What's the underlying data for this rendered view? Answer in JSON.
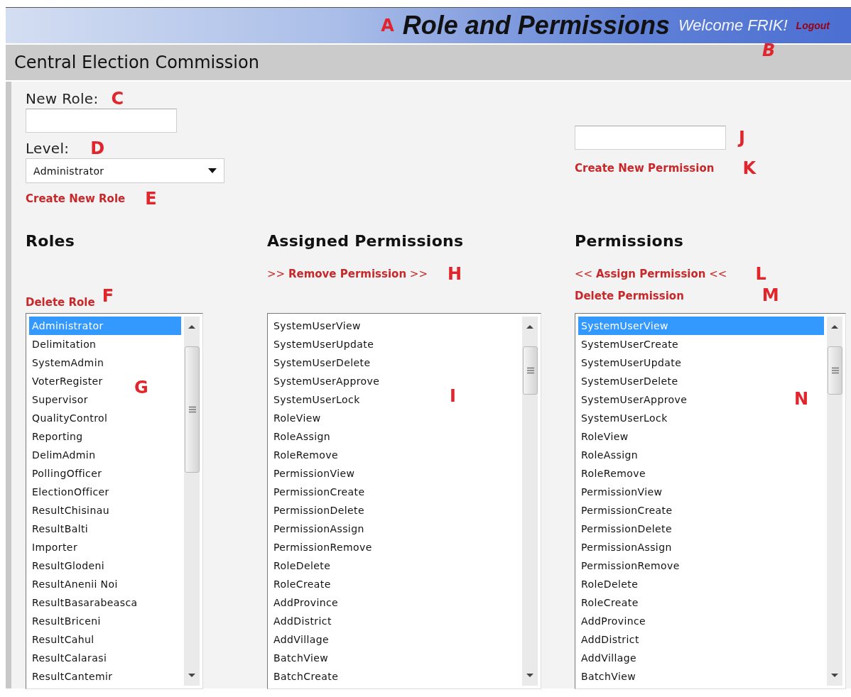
{
  "header": {
    "callout": "A",
    "title": "Role and Permissions",
    "welcome": "Welcome FRIK!",
    "welcome_callout": "B",
    "logout": "Logout"
  },
  "organization": "Central Election Commission",
  "new_role": {
    "label": "New Role:",
    "callout": "C"
  },
  "level": {
    "label": "Level:",
    "callout": "D",
    "value": "Administrator"
  },
  "create_role_link": {
    "text": "Create New Role",
    "callout": "E"
  },
  "new_permission": {
    "callout": "J"
  },
  "create_permission_link": {
    "text": "Create New Permission",
    "callout": "K"
  },
  "roles": {
    "heading": "Roles",
    "delete_link": {
      "text": "Delete Role",
      "callout": "F"
    },
    "list_callout": "G",
    "items": [
      {
        "label": "Administrator",
        "selected": true
      },
      {
        "label": "Delimitation",
        "selected": false
      },
      {
        "label": "SystemAdmin",
        "selected": false
      },
      {
        "label": "VoterRegister",
        "selected": false
      },
      {
        "label": "Supervisor",
        "selected": false
      },
      {
        "label": "QualityControl",
        "selected": false
      },
      {
        "label": "Reporting",
        "selected": false
      },
      {
        "label": "DelimAdmin",
        "selected": false
      },
      {
        "label": "PollingOfficer",
        "selected": false
      },
      {
        "label": "ElectionOfficer",
        "selected": false
      },
      {
        "label": "ResultChisinau",
        "selected": false
      },
      {
        "label": "ResultBalti",
        "selected": false
      },
      {
        "label": "Importer",
        "selected": false
      },
      {
        "label": "ResultGlodeni",
        "selected": false
      },
      {
        "label": "ResultAnenii Noi",
        "selected": false
      },
      {
        "label": "ResultBasarabeasca",
        "selected": false
      },
      {
        "label": "ResultBriceni",
        "selected": false
      },
      {
        "label": "ResultCahul",
        "selected": false
      },
      {
        "label": "ResultCalarasi",
        "selected": false
      },
      {
        "label": "ResultCantemir",
        "selected": false
      }
    ]
  },
  "assigned": {
    "heading": "Assigned Permissions",
    "remove_link": {
      "text": ">> **Remove Permission** >>",
      "callout": "H"
    },
    "list_callout": "I",
    "items": [
      {
        "label": "SystemUserView",
        "selected": false
      },
      {
        "label": "SystemUserUpdate",
        "selected": false
      },
      {
        "label": "SystemUserDelete",
        "selected": false
      },
      {
        "label": "SystemUserApprove",
        "selected": false
      },
      {
        "label": "SystemUserLock",
        "selected": false
      },
      {
        "label": "RoleView",
        "selected": false
      },
      {
        "label": "RoleAssign",
        "selected": false
      },
      {
        "label": "RoleRemove",
        "selected": false
      },
      {
        "label": "PermissionView",
        "selected": false
      },
      {
        "label": "PermissionCreate",
        "selected": false
      },
      {
        "label": "PermissionDelete",
        "selected": false
      },
      {
        "label": "PermissionAssign",
        "selected": false
      },
      {
        "label": "PermissionRemove",
        "selected": false
      },
      {
        "label": "RoleDelete",
        "selected": false
      },
      {
        "label": "RoleCreate",
        "selected": false
      },
      {
        "label": "AddProvince",
        "selected": false
      },
      {
        "label": "AddDistrict",
        "selected": false
      },
      {
        "label": "AddVillage",
        "selected": false
      },
      {
        "label": "BatchView",
        "selected": false
      },
      {
        "label": "BatchCreate",
        "selected": false
      }
    ]
  },
  "permissions": {
    "heading": "Permissions",
    "assign_link": {
      "text": "<< **Assign Permission** <<",
      "callout": "L"
    },
    "delete_link": {
      "text": "Delete Permission",
      "callout": "M"
    },
    "list_callout": "N",
    "items": [
      {
        "label": "SystemUserView",
        "selected": true
      },
      {
        "label": "SystemUserCreate",
        "selected": false
      },
      {
        "label": "SystemUserUpdate",
        "selected": false
      },
      {
        "label": "SystemUserDelete",
        "selected": false
      },
      {
        "label": "SystemUserApprove",
        "selected": false
      },
      {
        "label": "SystemUserLock",
        "selected": false
      },
      {
        "label": "RoleView",
        "selected": false
      },
      {
        "label": "RoleAssign",
        "selected": false
      },
      {
        "label": "RoleRemove",
        "selected": false
      },
      {
        "label": "PermissionView",
        "selected": false
      },
      {
        "label": "PermissionCreate",
        "selected": false
      },
      {
        "label": "PermissionDelete",
        "selected": false
      },
      {
        "label": "PermissionAssign",
        "selected": false
      },
      {
        "label": "PermissionRemove",
        "selected": false
      },
      {
        "label": "RoleDelete",
        "selected": false
      },
      {
        "label": "RoleCreate",
        "selected": false
      },
      {
        "label": "AddProvince",
        "selected": false
      },
      {
        "label": "AddDistrict",
        "selected": false
      },
      {
        "label": "AddVillage",
        "selected": false
      },
      {
        "label": "BatchView",
        "selected": false
      }
    ]
  }
}
